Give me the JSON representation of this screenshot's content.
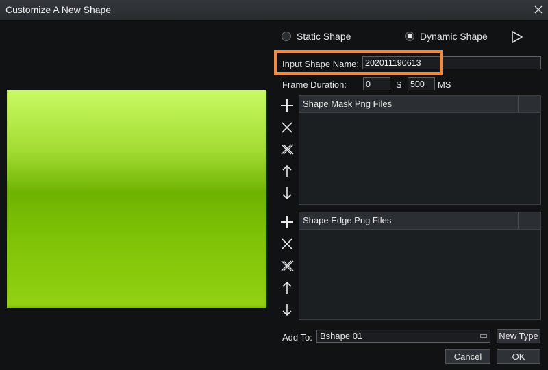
{
  "window": {
    "title": "Customize A New Shape"
  },
  "shape_type": {
    "static_label": "Static Shape",
    "dynamic_label": "Dynamic Shape",
    "selected": "Dynamic Shape"
  },
  "name": {
    "label": "Input Shape Name:",
    "value": "202011190613"
  },
  "duration": {
    "label": "Frame Duration:",
    "seconds": "0",
    "seconds_unit": "S",
    "ms": "500",
    "ms_unit": "MS"
  },
  "mask_list": {
    "header": "Shape Mask Png Files",
    "items": []
  },
  "edge_list": {
    "header": "Shape Edge Png Files",
    "items": []
  },
  "add_to": {
    "label": "Add To:",
    "value": "Bshape 01",
    "new_type_label": "New Type"
  },
  "actions": {
    "cancel_label": "Cancel",
    "ok_label": "OK"
  },
  "preview": {
    "colors": [
      "#c8fa62",
      "#6fb302",
      "#93d113"
    ]
  },
  "icons": [
    "close-icon",
    "play-icon",
    "add-icon",
    "remove-icon",
    "clear-all-icon",
    "move-up-icon",
    "move-down-icon"
  ]
}
